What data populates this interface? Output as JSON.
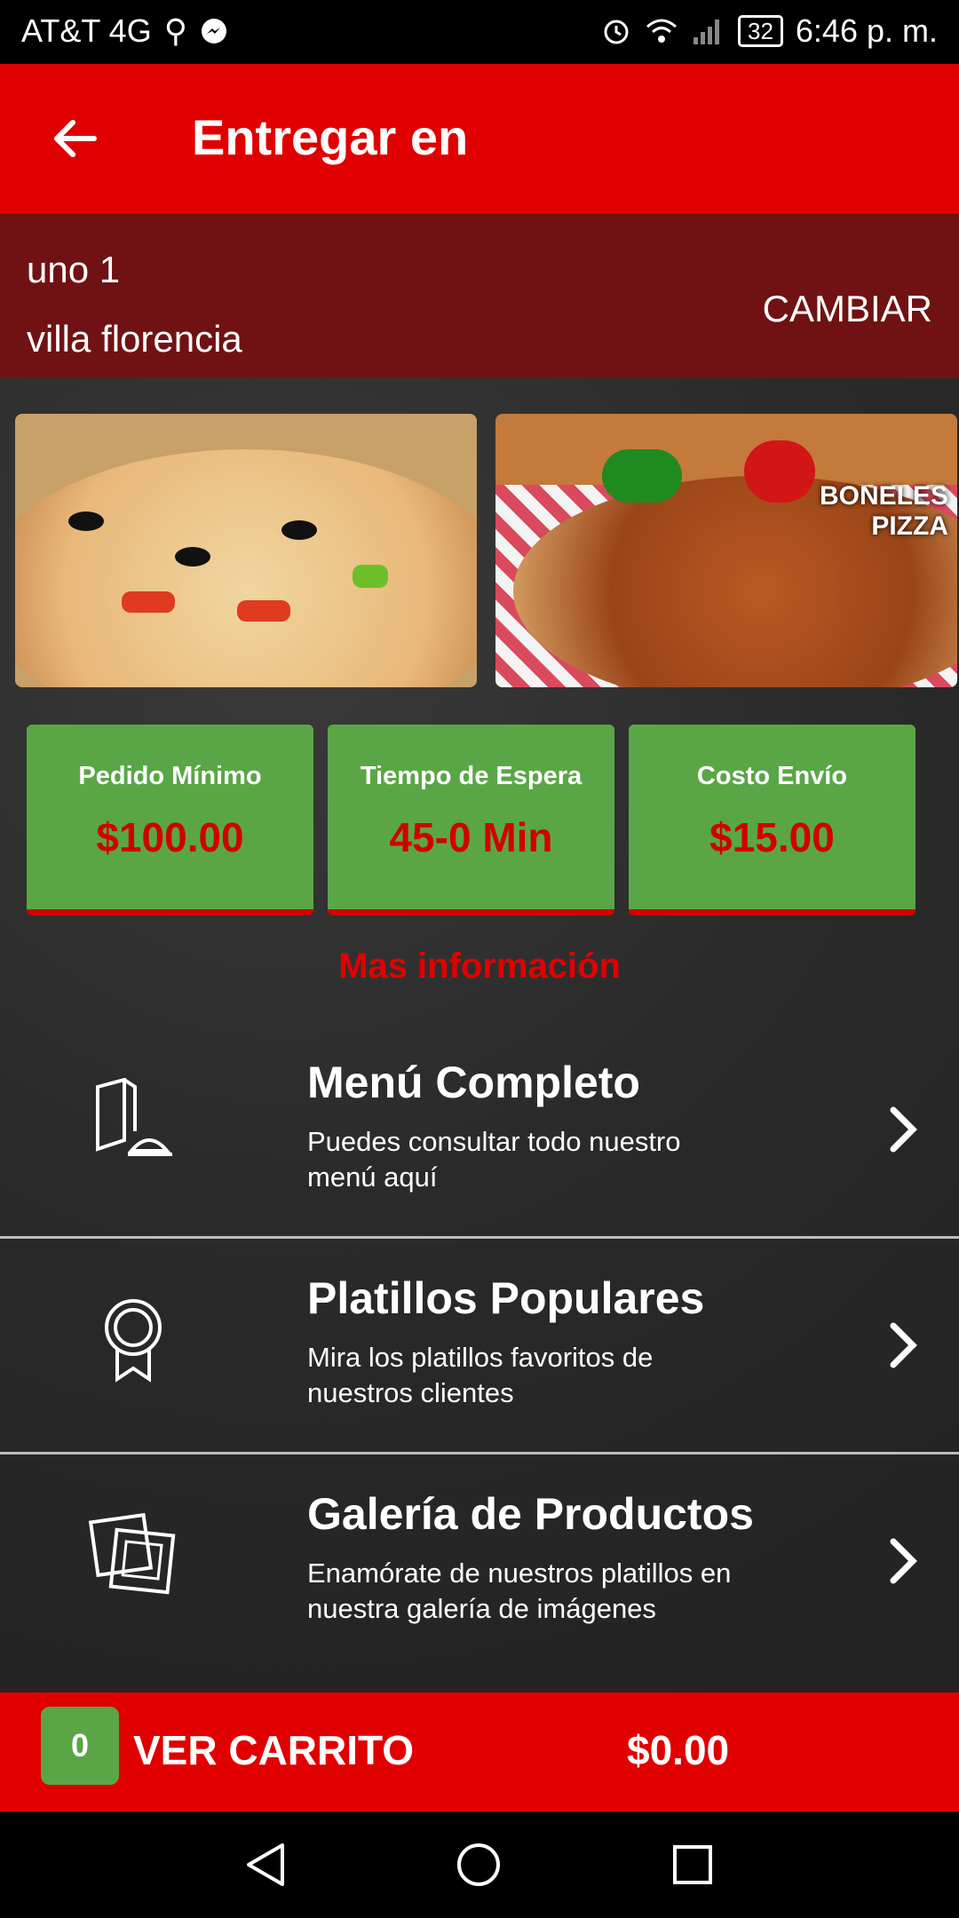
{
  "status_bar": {
    "carrier": "AT&T 4G",
    "battery": "32",
    "time": "6:46 p. m."
  },
  "app_bar": {
    "title": "Entregar en"
  },
  "address": {
    "line1": "uno 1",
    "line2": "villa florencia",
    "change_label": "CAMBIAR"
  },
  "promo_images": [
    {
      "icon": "pizza-photo"
    },
    {
      "icon": "pizza-photo",
      "overlay_text": [
        "BONELES",
        "PIZZA"
      ]
    }
  ],
  "info_cards": [
    {
      "label": "Pedido Mínimo",
      "value": "$100.00"
    },
    {
      "label": "Tiempo de Espera",
      "value": "45-0 Min"
    },
    {
      "label": "Costo Envío",
      "value": "$15.00"
    }
  ],
  "more_info_label": "Mas información",
  "menu_items": [
    {
      "title": "Menú Completo",
      "desc": "Puedes consultar todo nuestro menú aquí",
      "icon": "menu-serving-icon"
    },
    {
      "title": "Platillos Populares",
      "desc": "Mira los platillos favoritos de nuestros clientes",
      "icon": "award-badge-icon"
    },
    {
      "title": "Galería de Productos",
      "desc": "Enamórate de nuestros platillos en nuestra galería de imágenes",
      "icon": "photos-icon"
    }
  ],
  "cart": {
    "count": "0",
    "label": "VER CARRITO",
    "total": "$0.00"
  },
  "colors": {
    "primary_red": "#e10000",
    "address_bg": "#701214",
    "card_green": "#5aa646"
  }
}
